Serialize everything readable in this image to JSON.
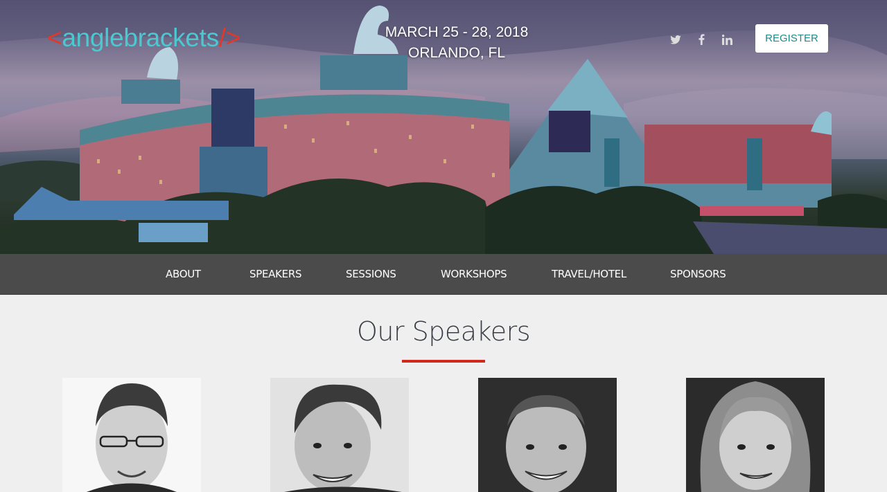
{
  "header": {
    "logo_open": "<",
    "logo_name": "anglebrackets",
    "logo_close": "/>",
    "event_dates": "MARCH 25 - 28, 2018",
    "event_location": "ORLANDO, FL",
    "social": [
      "twitter-icon",
      "facebook-icon",
      "linkedin-icon"
    ],
    "register_label": "REGISTER"
  },
  "nav": {
    "items": [
      {
        "label": "ABOUT"
      },
      {
        "label": "SPEAKERS"
      },
      {
        "label": "SESSIONS"
      },
      {
        "label": "WORKSHOPS"
      },
      {
        "label": "TRAVEL/HOTEL"
      },
      {
        "label": "SPONSORS"
      }
    ]
  },
  "main": {
    "section_title": "Our Speakers"
  },
  "colors": {
    "brand_red": "#e0392b",
    "brand_teal": "#4cc8d0",
    "nav_bg": "#4b4b4b",
    "accent_rule": "#d0281c",
    "register_text": "#1f8a86"
  }
}
